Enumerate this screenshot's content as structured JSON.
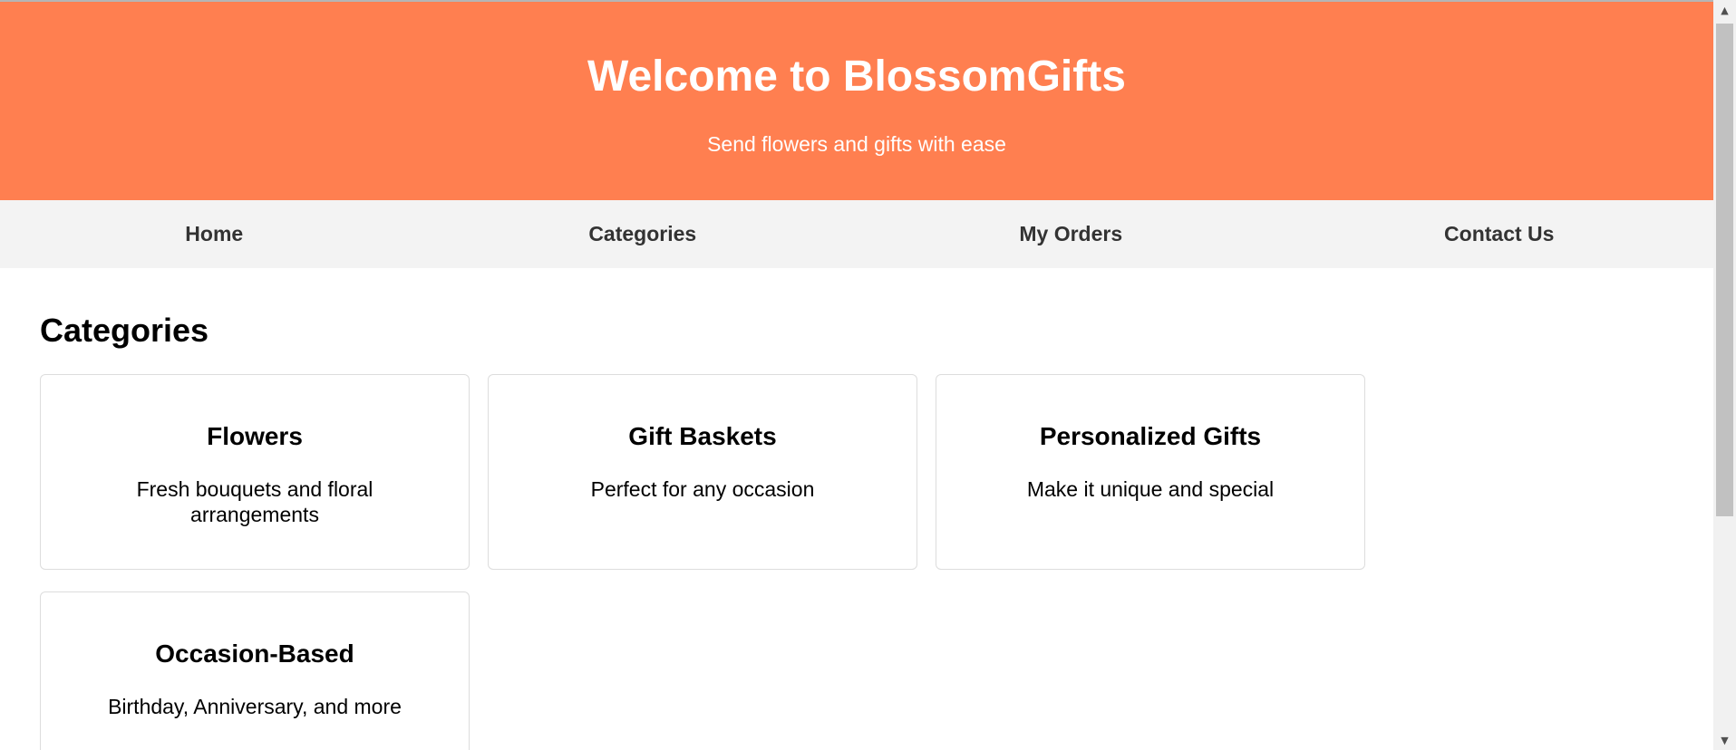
{
  "header": {
    "title": "Welcome to BlossomGifts",
    "subtitle": "Send flowers and gifts with ease"
  },
  "nav": {
    "items": [
      {
        "label": "Home"
      },
      {
        "label": "Categories"
      },
      {
        "label": "My Orders"
      },
      {
        "label": "Contact Us"
      }
    ]
  },
  "main": {
    "section_title": "Categories",
    "categories": [
      {
        "title": "Flowers",
        "description": "Fresh bouquets and floral arrangements"
      },
      {
        "title": "Gift Baskets",
        "description": "Perfect for any occasion"
      },
      {
        "title": "Personalized Gifts",
        "description": "Make it unique and special"
      },
      {
        "title": "Occasion-Based",
        "description": "Birthday, Anniversary, and more"
      }
    ]
  },
  "scrollbar": {
    "up_icon": "arrow-up-icon",
    "down_icon": "arrow-down-icon"
  },
  "colors": {
    "header_bg": "#ff7f50",
    "header_text": "#ffffff",
    "nav_bg": "#f3f3f3",
    "nav_text": "#333333",
    "card_border": "#dddddd"
  }
}
